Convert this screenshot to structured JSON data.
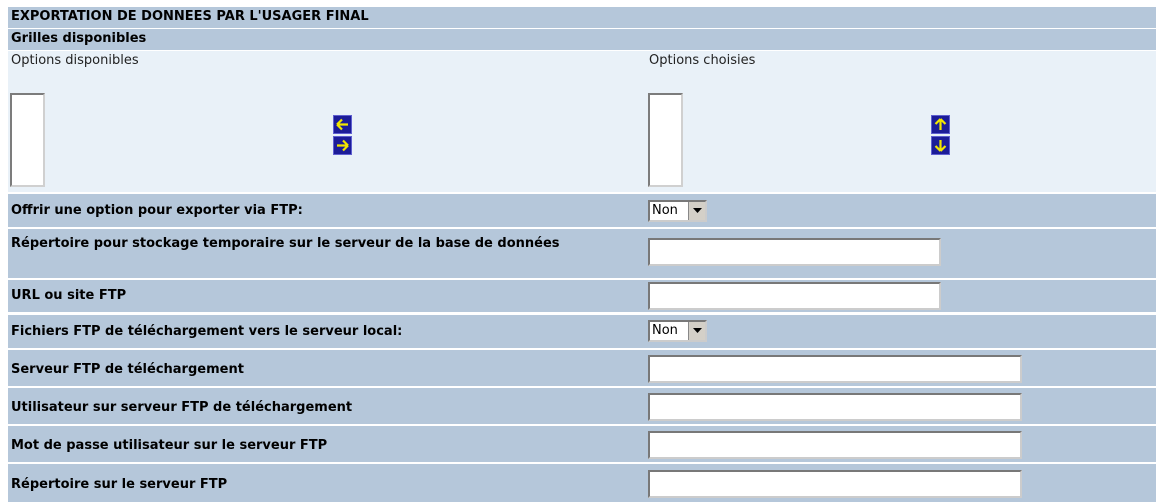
{
  "page": {
    "title": "EXPORTATION DE DONNEES PAR L'USAGER FINAL",
    "section": "Grilles disponibles"
  },
  "options": {
    "available_label": "Options disponibles",
    "chosen_label": "Options choisies",
    "available_items": [],
    "chosen_items": [],
    "move_buttons": [
      "arrow-left-icon",
      "arrow-right-icon"
    ],
    "order_buttons": [
      "arrow-up-icon",
      "arrow-down-icon"
    ]
  },
  "fields": {
    "ftp_export": {
      "label": "Offrir une option pour exporter via FTP:",
      "value": "Non"
    },
    "temp_dir": {
      "label": "Répertoire pour stockage temporaire sur le serveur de la base de données",
      "value": ""
    },
    "ftp_url": {
      "label": "URL ou site FTP",
      "value": ""
    },
    "ftp_upload": {
      "label": "Fichiers FTP de téléchargement vers le serveur local:",
      "value": "Non"
    },
    "ftp_server": {
      "label": "Serveur FTP de téléchargement",
      "value": ""
    },
    "ftp_user": {
      "label": "Utilisateur sur serveur FTP de téléchargement",
      "value": ""
    },
    "ftp_password": {
      "label": "Mot de passe utilisateur sur le serveur FTP",
      "value": ""
    },
    "ftp_dir": {
      "label": "Répertoire sur le serveur FTP",
      "value": ""
    }
  },
  "colors": {
    "header_bg": "#b5c7da",
    "light_bg": "#e9f1f8",
    "button_bg": "#1c1c98",
    "arrow_color": "#f2e600"
  }
}
